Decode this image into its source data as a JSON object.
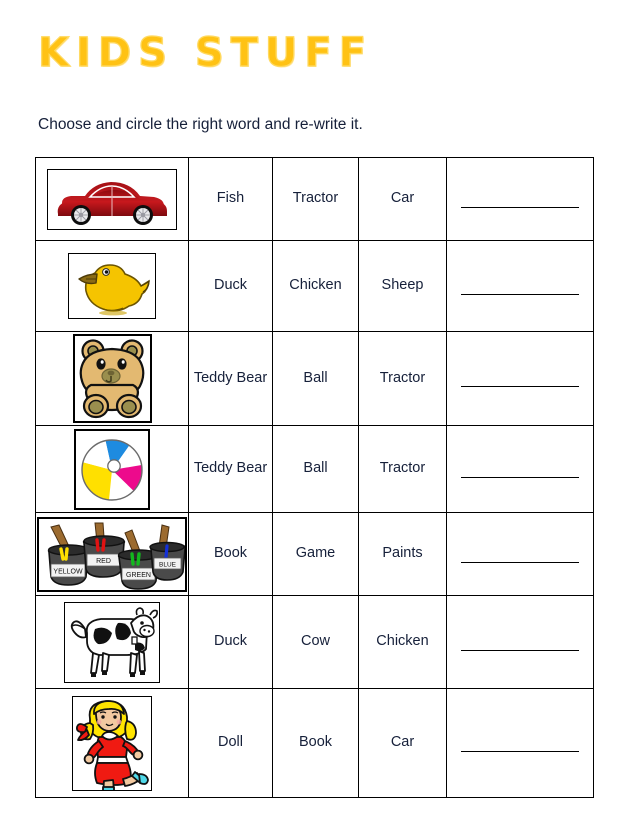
{
  "page": {
    "title": "KIDS STUFF",
    "instruction": "Choose and circle the right word and re-write it."
  },
  "colors": {
    "title": "#FFC214",
    "title_highlight": "#FFD95E",
    "text": "#16203a",
    "rule": "#000000",
    "car_body": "#B01217",
    "duck_body": "#F5C400",
    "teddy_body": "#E3B971",
    "teddy_shade": "#9A8F4E",
    "ball_yellow": "#FFE000",
    "ball_blue": "#1E8BE0",
    "ball_pink": "#ED0A8C",
    "pot_grey": "#4A4A4A",
    "doll_dress": "#F01A12",
    "doll_hair": "#FFE400",
    "doll_shoes": "#4FD8E8",
    "cow_black": "#111111"
  },
  "table": {
    "columns": [
      "picture",
      "option_1",
      "option_2",
      "option_3",
      "answer"
    ],
    "rows": [
      {
        "picture": "car-image",
        "picture_label": "red car",
        "options": [
          "Fish",
          "Tractor",
          "Car"
        ],
        "answer": ""
      },
      {
        "picture": "duck-image",
        "picture_label": "yellow duck",
        "options": [
          "Duck",
          "Chicken",
          "Sheep"
        ],
        "answer": ""
      },
      {
        "picture": "teddy-bear-image",
        "picture_label": "teddy bear",
        "options": [
          "Teddy Bear",
          "Ball",
          "Tractor"
        ],
        "answer": ""
      },
      {
        "picture": "beach-ball-image",
        "picture_label": "beach ball",
        "options": [
          "Teddy Bear",
          "Ball",
          "Tractor"
        ],
        "answer": ""
      },
      {
        "picture": "paint-pots-image",
        "picture_label": "paint pots",
        "paint_labels": [
          "YELLOW",
          "RED",
          "GREEN",
          "BLUE"
        ],
        "options": [
          "Book",
          "Game",
          "Paints"
        ],
        "answer": ""
      },
      {
        "picture": "cow-image",
        "picture_label": "cow",
        "options": [
          "Duck",
          "Cow",
          "Chicken"
        ],
        "answer": ""
      },
      {
        "picture": "doll-image",
        "picture_label": "doll",
        "options": [
          "Doll",
          "Book",
          "Car"
        ],
        "answer": ""
      }
    ]
  }
}
